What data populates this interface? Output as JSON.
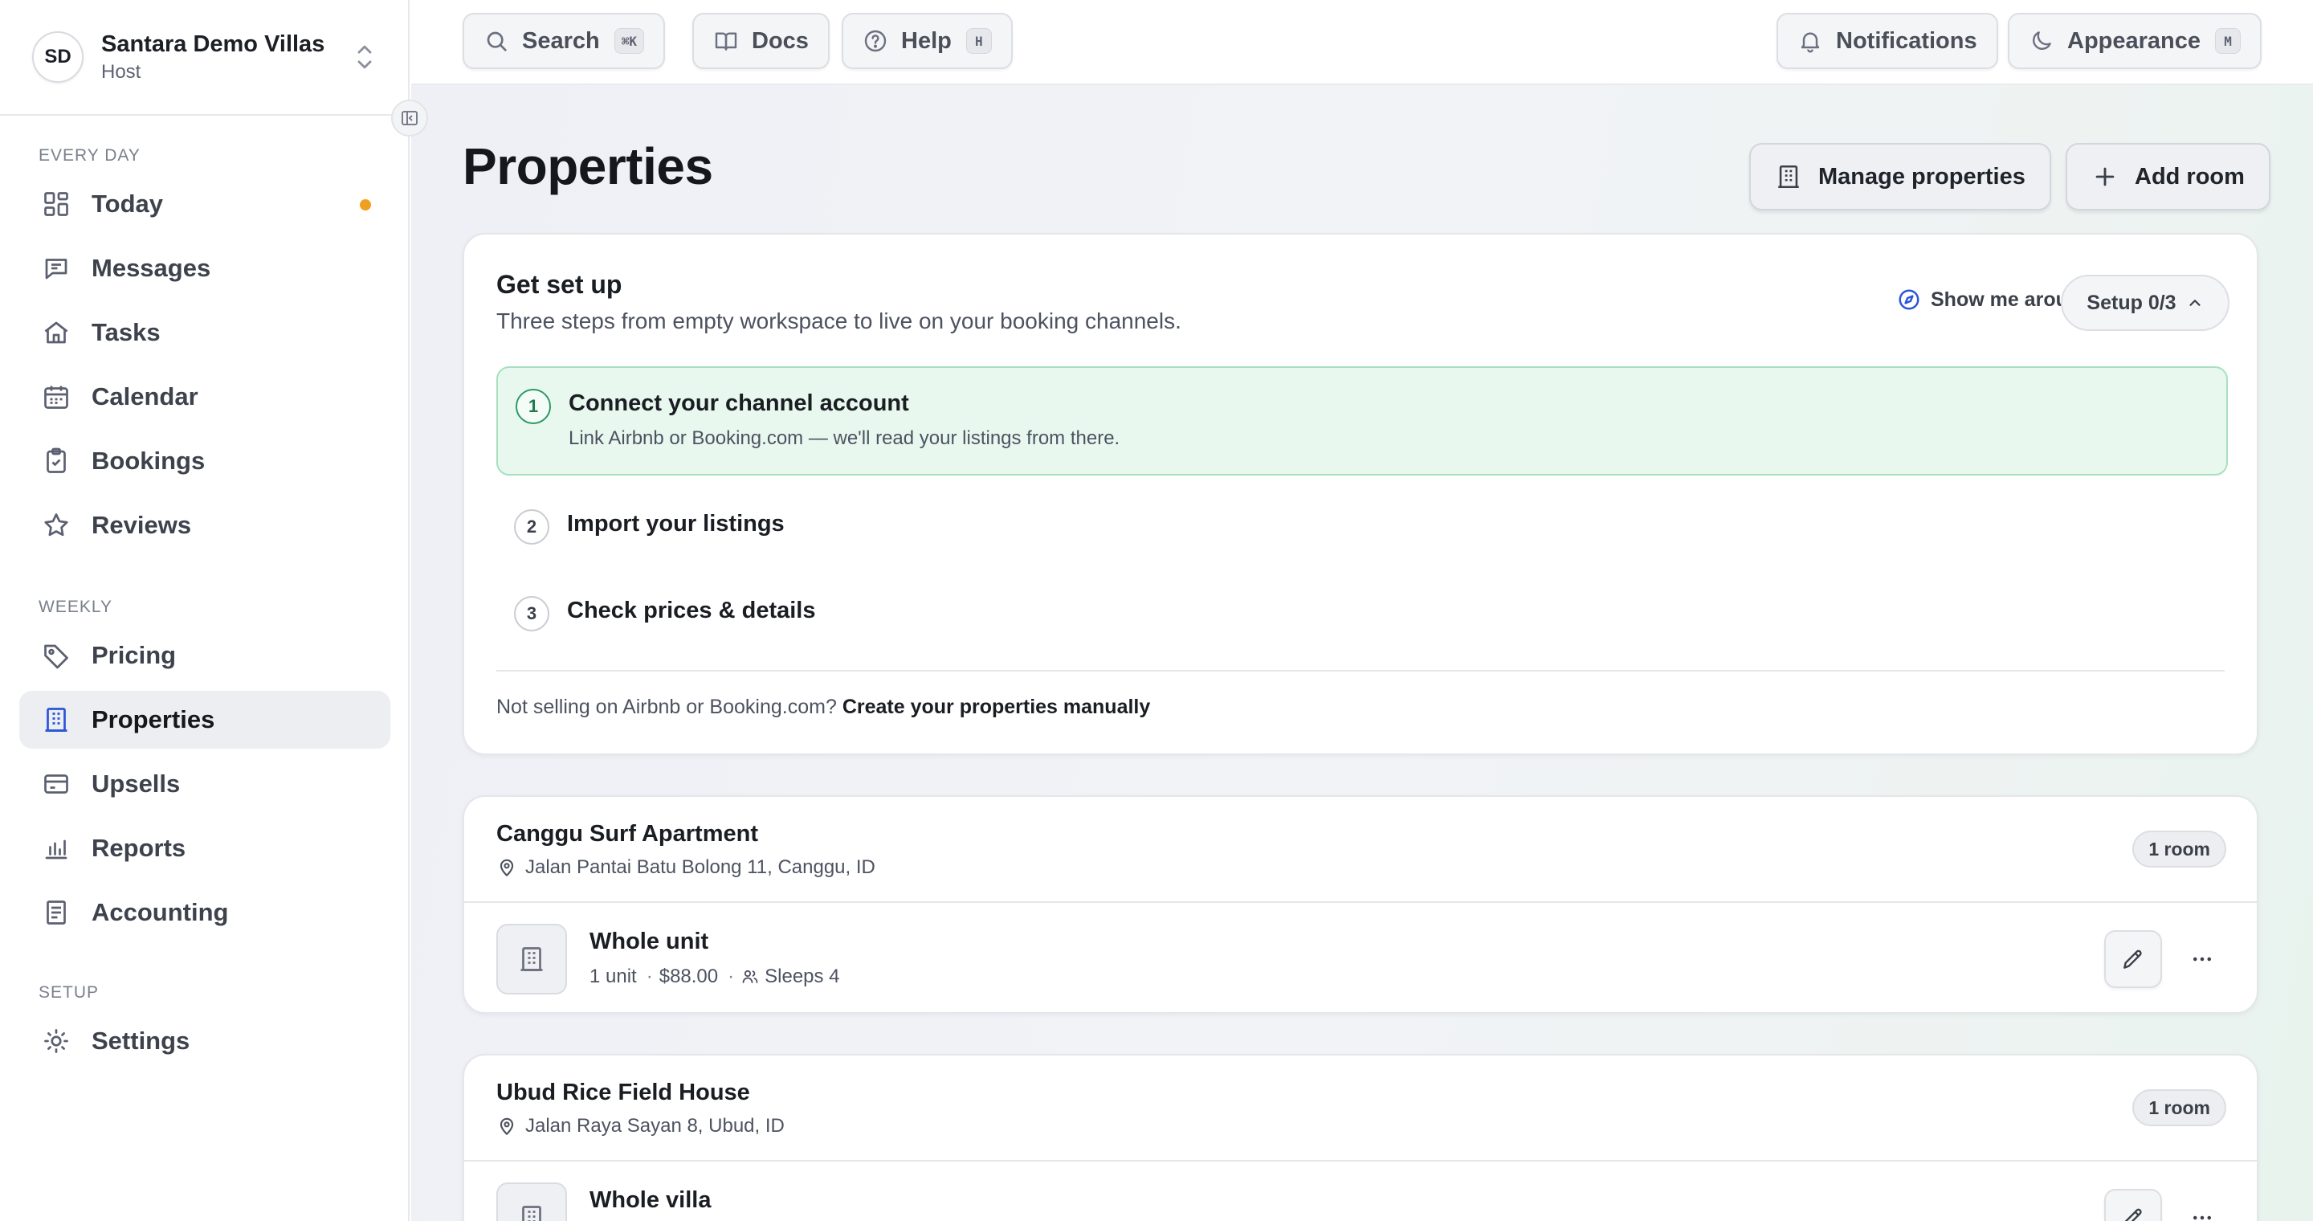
{
  "workspace": {
    "initials": "SD",
    "name": "Santara Demo Villas",
    "role": "Host"
  },
  "sidebar": {
    "sections": [
      {
        "heading": "EVERY DAY",
        "items": [
          {
            "label": "Today",
            "icon": "dashboard-icon",
            "dot": true
          },
          {
            "label": "Messages",
            "icon": "message-icon"
          },
          {
            "label": "Tasks",
            "icon": "home-icon"
          },
          {
            "label": "Calendar",
            "icon": "calendar-icon"
          },
          {
            "label": "Bookings",
            "icon": "clipboard-check-icon"
          },
          {
            "label": "Reviews",
            "icon": "star-icon"
          }
        ]
      },
      {
        "heading": "WEEKLY",
        "items": [
          {
            "label": "Pricing",
            "icon": "tag-icon"
          },
          {
            "label": "Properties",
            "icon": "building-icon",
            "active": true
          },
          {
            "label": "Upsells",
            "icon": "credit-card-icon"
          },
          {
            "label": "Reports",
            "icon": "bar-chart-icon"
          },
          {
            "label": "Accounting",
            "icon": "ledger-icon"
          }
        ]
      },
      {
        "heading": "SETUP",
        "items": [
          {
            "label": "Settings",
            "icon": "sun-gear-icon"
          }
        ]
      }
    ]
  },
  "topbar": {
    "search": {
      "label": "Search",
      "kbd": "⌘K"
    },
    "docs": {
      "label": "Docs"
    },
    "help": {
      "label": "Help",
      "kbd": "H"
    },
    "notifications": {
      "label": "Notifications"
    },
    "appearance": {
      "label": "Appearance",
      "kbd": "M"
    }
  },
  "page": {
    "title": "Properties",
    "manage_label": "Manage properties",
    "add_room_label": "Add room"
  },
  "setup": {
    "title": "Get set up",
    "subtitle": "Three steps from empty workspace to live on your booking channels.",
    "tour_label": "Show me around",
    "progress_label": "Setup 0/3",
    "steps": [
      {
        "num": "1",
        "title": "Connect your channel account",
        "desc": "Link Airbnb or Booking.com — we'll read your listings from there.",
        "active": true
      },
      {
        "num": "2",
        "title": "Import your listings"
      },
      {
        "num": "3",
        "title": "Check prices & details"
      }
    ],
    "manual_prefix": "Not selling on Airbnb or Booking.com?",
    "manual_link": "Create your properties manually"
  },
  "properties": [
    {
      "name": "Canggu Surf Apartment",
      "address": "Jalan Pantai Batu Bolong 11, Canggu, ID",
      "badge": "1 room",
      "room": {
        "name": "Whole unit",
        "units": "1 unit",
        "price": "$88.00",
        "sleeps": "Sleeps 4"
      }
    },
    {
      "name": "Ubud Rice Field House",
      "address": "Jalan Raya Sayan 8, Ubud, ID",
      "badge": "1 room",
      "room": {
        "name": "Whole villa"
      }
    }
  ],
  "colors": {
    "accent": "#2a55d9",
    "success_bg": "#e8f8ef",
    "success_border": "#a7e0bf",
    "notice_dot": "#f0a020"
  }
}
